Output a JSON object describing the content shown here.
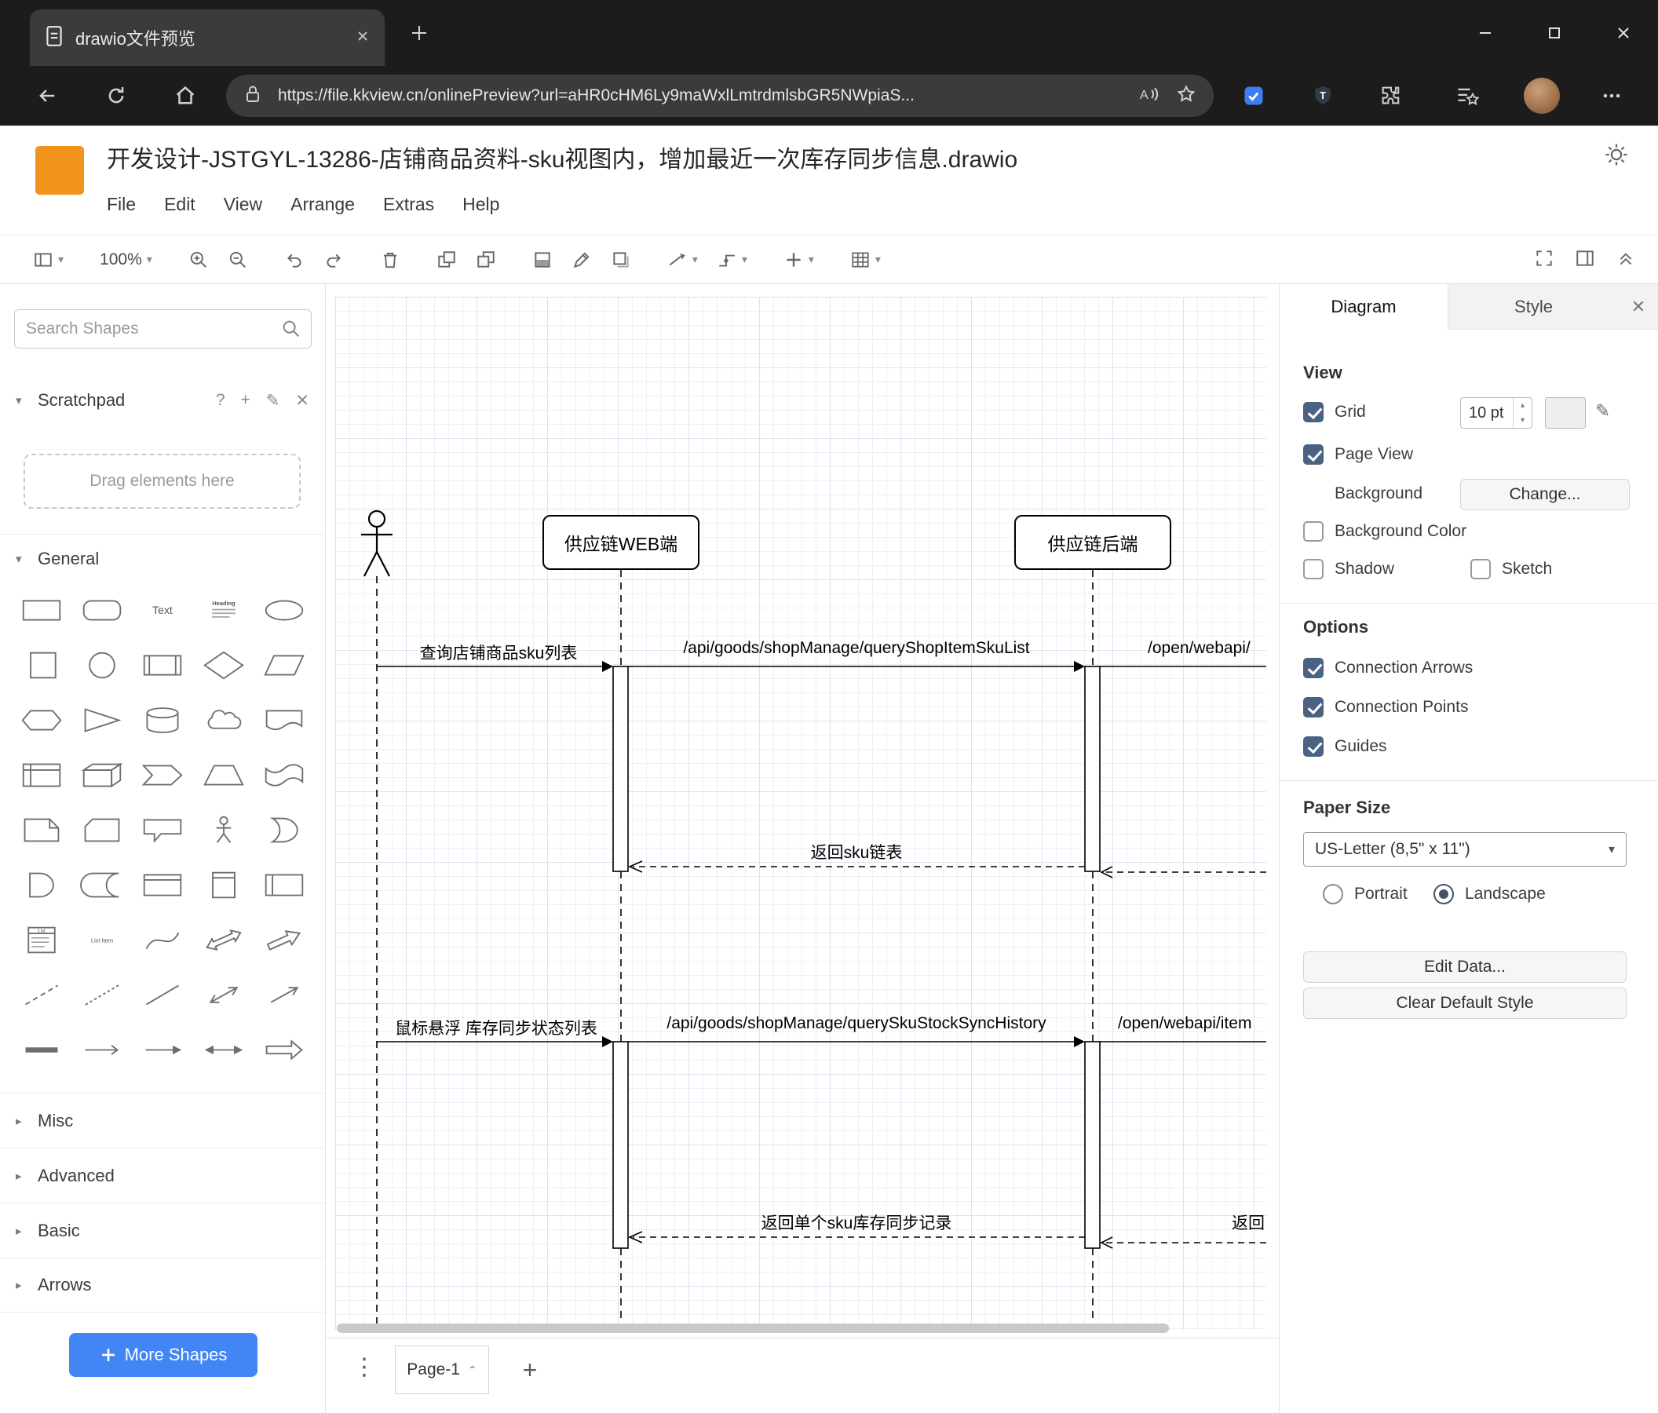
{
  "browser": {
    "tab_title": "drawio文件预览",
    "url": "https://file.kkview.cn/onlinePreview?url=aHR0cHM6Ly9maWxlLmtrdmlsbGR5NWpiaS..."
  },
  "app": {
    "title": "开发设计-JSTGYL-13286-店铺商品资料-sku视图内，增加最近一次库存同步信息.drawio",
    "menus": [
      "File",
      "Edit",
      "View",
      "Arrange",
      "Extras",
      "Help"
    ],
    "toolbar": {
      "zoom": "100%"
    }
  },
  "sidebar": {
    "search_placeholder": "Search Shapes",
    "scratchpad": {
      "title": "Scratchpad",
      "drag_hint": "Drag elements here"
    },
    "sections": {
      "general": "General",
      "collapsed": [
        "Misc",
        "Advanced",
        "Basic",
        "Arrows"
      ]
    },
    "more_shapes_label": "More Shapes",
    "palette_text": {
      "text": "Text",
      "heading": "Heading",
      "list": "List",
      "list_item": "List Item"
    },
    "palette_shapes": [
      "rectangle",
      "rounded-rectangle",
      "text",
      "textbox",
      "ellipse",
      "square",
      "circle",
      "process",
      "diamond",
      "parallelogram",
      "hexagon",
      "triangle",
      "cylinder",
      "cloud",
      "document",
      "internal-storage",
      "cube",
      "step",
      "trapezoid",
      "tape",
      "note",
      "card",
      "callout",
      "actor",
      "or",
      "and",
      "data-storage",
      "container",
      "vertical-container",
      "horizontal-pool",
      "list",
      "list-item",
      "curve",
      "bidirectional-arrow",
      "arrow",
      "dashed-line",
      "dotted-line",
      "line",
      "bidirectional-connector",
      "directional-connector",
      "link",
      "arrow-right-thin",
      "arrow-right",
      "arrow-both",
      "arrow-block"
    ]
  },
  "canvas": {
    "diagram": {
      "actors": {
        "web": "供应链WEB端",
        "backend": "供应链后端"
      },
      "messages": {
        "m1": "查询店铺商品sku列表",
        "m2": "/api/goods/shopManage/queryShopItemSkuList",
        "m3": "/open/webapi/",
        "r1": "返回sku链表",
        "m4": "鼠标悬浮 库存同步状态列表",
        "m5": "/api/goods/shopManage/querySkuStockSyncHistory",
        "m6": "/open/webapi/item",
        "r2": "返回单个sku库存同步记录",
        "r2b": "返回"
      }
    }
  },
  "footer": {
    "page_tab": "Page-1"
  },
  "format_panel": {
    "tabs": {
      "diagram": "Diagram",
      "style": "Style"
    },
    "view": {
      "title": "View",
      "grid": "Grid",
      "grid_size": "10 pt",
      "page_view": "Page View",
      "background": "Background",
      "change_button": "Change...",
      "background_color": "Background Color",
      "shadow": "Shadow",
      "sketch": "Sketch"
    },
    "options": {
      "title": "Options",
      "connection_arrows": "Connection Arrows",
      "connection_points": "Connection Points",
      "guides": "Guides"
    },
    "paper": {
      "title": "Paper Size",
      "size": "US-Letter (8,5\" x 11\")",
      "portrait": "Portrait",
      "landscape": "Landscape"
    },
    "buttons": {
      "edit_data": "Edit Data...",
      "clear_default_style": "Clear Default Style"
    },
    "state": {
      "grid": true,
      "page_view": true,
      "background_color": false,
      "shadow": false,
      "sketch": false,
      "connection_arrows": true,
      "connection_points": true,
      "guides": true,
      "portrait": false,
      "landscape": true
    }
  },
  "colors": {
    "accent_blue": "#4285f4",
    "drawio_orange": "#F2931E",
    "checkbox_accent": "#4a6283"
  }
}
